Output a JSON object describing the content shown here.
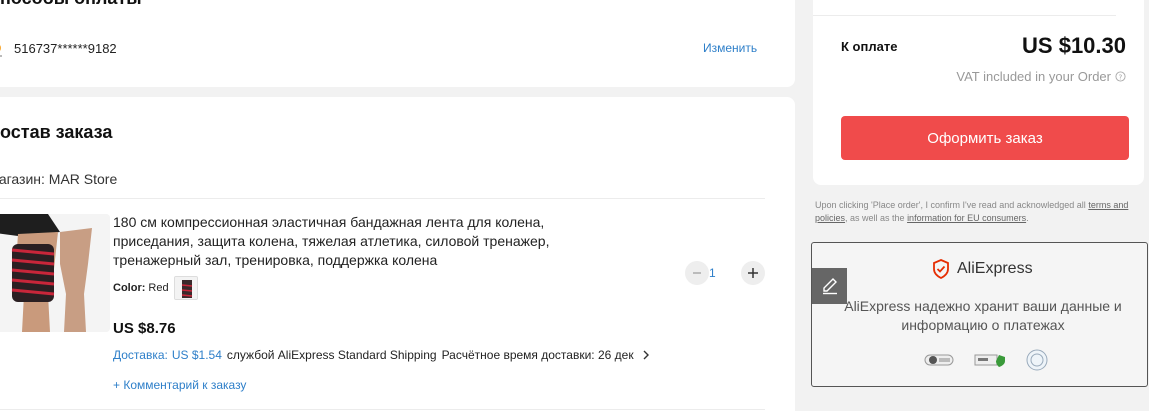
{
  "payment": {
    "title": "Способы оплаты",
    "card_number": "516737******9182",
    "change_label": "Изменить"
  },
  "order": {
    "title": "Состав заказа",
    "store_label": "Магазин: MAR Store",
    "product": {
      "title": "180 см компрессионная эластичная бандажная лента для колена, приседания, защита колена, тяжелая атлетика, силовой тренажер, тренажерный зал, тренировка, поддержка колена",
      "color_label": "Color:",
      "color_value": "Red",
      "price": "US $8.76",
      "quantity": "1",
      "shipping_label": "Доставка:",
      "shipping_cost": "US $1.54",
      "shipping_service": "службой AliExpress Standard Shipping",
      "shipping_eta": "Расчётное время доставки: 26 дек",
      "comment_label": "+ Комментарий к заказу"
    }
  },
  "summary": {
    "pay_label": "К оплате",
    "total": "US $10.30",
    "vat_note": "VAT included in your Order",
    "place_order_label": "Оформить заказ",
    "consent_prefix": "Upon clicking 'Place order', I confirm I've read and acknowledged all",
    "consent_link_1": "terms and policies",
    "consent_middle": ", as well as the",
    "consent_link_2": "information for EU consumers",
    "consent_suffix": "."
  },
  "security": {
    "brand": "AliExpress",
    "text": "AliExpress надежно хранит ваши данные и информацию о платежах",
    "badges": [
      "lock-badge-icon",
      "card-badge-icon",
      "seal-badge-icon"
    ]
  },
  "colors": {
    "accent_red": "#f04b4b",
    "link_blue": "#2e7fc9",
    "brand_red": "#e62e04"
  }
}
